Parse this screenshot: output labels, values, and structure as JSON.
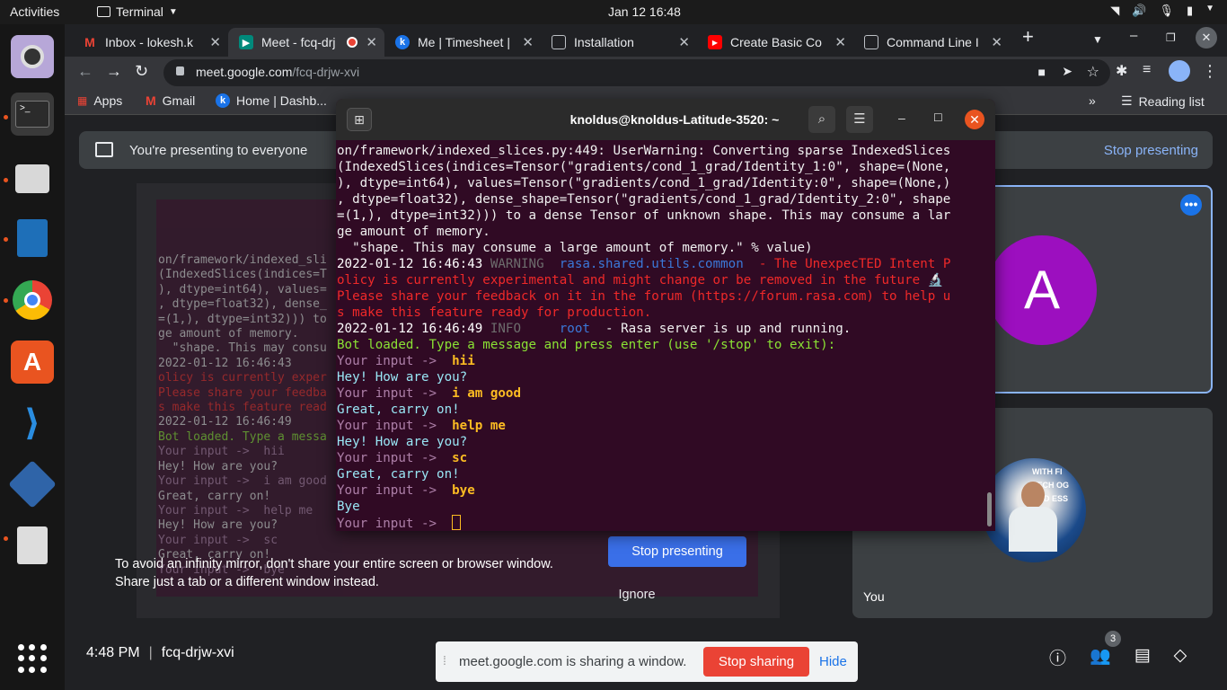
{
  "system": {
    "activities": "Activities",
    "app_menu": "Terminal",
    "clock": "Jan 12  16:48"
  },
  "browser": {
    "tabs": [
      {
        "label": "Inbox - lokesh.k",
        "color": "#ea4335"
      },
      {
        "label": "Meet - fcq-drj",
        "color": "#00897b"
      },
      {
        "label": "Me | Timesheet |",
        "color": "#1a73e8"
      },
      {
        "label": "Installation",
        "color": "#5f6368"
      },
      {
        "label": "Create Basic Co",
        "color": "#ff0000"
      },
      {
        "label": "Command Line I",
        "color": "#5f6368"
      }
    ],
    "url_host": "meet.google.com",
    "url_path": "/fcq-drjw-xvi",
    "bookmarks": [
      "Apps",
      "Gmail",
      "Home | Dashb..."
    ],
    "reading_list": "Reading list"
  },
  "meet": {
    "banner": "You're presenting to everyone",
    "banner_stop": "Stop presenting",
    "mirror_warning_line1": "To avoid an infinity mirror, don't share your entire screen or browser window.",
    "mirror_warning_line2": "Share just a tab or a different window instead.",
    "stop_presenting_button": "Stop presenting",
    "ignore_button": "Ignore",
    "participant_initial": "A",
    "you_label": "You",
    "you_photo_text": "WITH FI\nTECH OG\nAND ESS",
    "time": "4:48 PM",
    "meeting_code": "fcq-drjw-xvi",
    "people_count": "3"
  },
  "sharebar": {
    "message": "meet.google.com is sharing a window.",
    "stop_sharing": "Stop sharing",
    "hide": "Hide"
  },
  "terminal": {
    "title": "knoldus@knoldus-Latitude-3520: ~",
    "lines": [
      "on/framework/indexed_slices.py:449: UserWarning: Converting sparse IndexedSlices",
      "(IndexedSlices(indices=Tensor(\"gradients/cond_1_grad/Identity_1:0\", shape=(None,",
      "), dtype=int64), values=Tensor(\"gradients/cond_1_grad/Identity:0\", shape=(None,)",
      ", dtype=float32), dense_shape=Tensor(\"gradients/cond_1_grad/Identity_2:0\", shape",
      "=(1,), dtype=int32))) to a dense Tensor of unknown shape. This may consume a lar",
      "ge amount of memory.",
      "  \"shape. This may consume a large amount of memory.\" % value)"
    ],
    "warn_time": "2022-01-12 16:46:43",
    "warn_level": "WARNING",
    "warn_logger": "rasa.shared.utils.common",
    "warn_msg_1": "- The UnexpecTED Intent P",
    "warn_msg_2": "olicy is currently experimental and might change or be removed in the future 🔬",
    "warn_msg_3": "Please share your feedback on it in the forum (https://forum.rasa.com) to help u",
    "warn_msg_4": "s make this feature ready for production.",
    "info_time": "2022-01-12 16:46:49",
    "info_level": "INFO",
    "info_logger": "root",
    "info_msg": "- Rasa server is up and running.",
    "bot_loaded": "Bot loaded. Type a message and press enter (use '/stop' to exit):",
    "prompt": "Your input ->",
    "conversation": [
      {
        "user": "hii",
        "bot": "Hey! How are you?"
      },
      {
        "user": "i am good",
        "bot": "Great, carry on!"
      },
      {
        "user": "help me",
        "bot": "Hey! How are you?"
      },
      {
        "user": "sc",
        "bot": "Great, carry on!"
      },
      {
        "user": "bye",
        "bot": "Bye"
      }
    ]
  },
  "mirror": {
    "lines": [
      "on/framework/indexed_sli",
      "(IndexedSlices(indices=T",
      "), dtype=int64), values=",
      ", dtype=float32), dense_",
      "=(1,), dtype=int32))) to",
      "ge amount of memory.",
      "  \"shape. This may consu",
      "2022-01-12 16:46:43",
      "olicy is currently exper",
      "Please share your feedba",
      "s make this feature read",
      "2022-01-12 16:46:49",
      "Bot loaded. Type a messa",
      "Your input ->  hii",
      "Hey! How are you?",
      "Your input ->  i am good",
      "Great, carry on!",
      "Your input ->  help me",
      "Hey! How are you?",
      "Your input ->  sc",
      "Great, carry on!",
      "Your input ->  bye"
    ]
  }
}
